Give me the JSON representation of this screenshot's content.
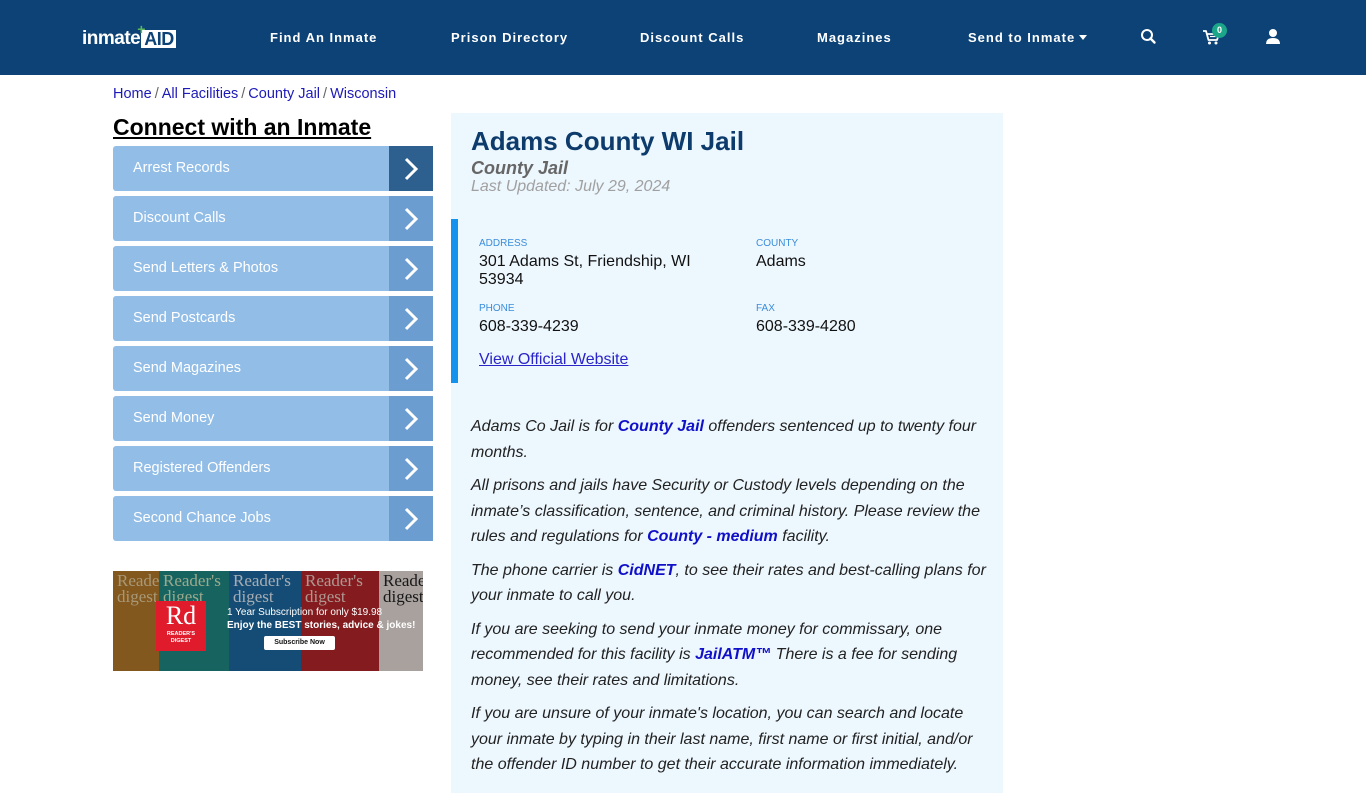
{
  "header": {
    "logo": {
      "part1": "inmate",
      "part2": "AID",
      "plus": "+"
    },
    "nav": [
      {
        "label": "Find An Inmate"
      },
      {
        "label": "Prison Directory"
      },
      {
        "label": "Discount Calls"
      },
      {
        "label": "Magazines"
      },
      {
        "label": "Send to Inmate",
        "has_dropdown": true
      }
    ],
    "icons": {
      "search": "search-icon",
      "cart": "cart-icon",
      "user": "user-icon"
    },
    "cart_count": "0",
    "colors": {
      "background": "#0c4276",
      "badge": "#1ba589"
    }
  },
  "breadcrumb": [
    {
      "label": "Home"
    },
    {
      "label": "All Facilities"
    },
    {
      "label": "County Jail"
    },
    {
      "label": "Wisconsin"
    }
  ],
  "breadcrumb_sep": "/",
  "sidebar": {
    "title": "Connect with an Inmate",
    "items": [
      {
        "label": "Arrest Records",
        "active": true
      },
      {
        "label": "Discount Calls"
      },
      {
        "label": "Send Letters & Photos"
      },
      {
        "label": "Send Postcards"
      },
      {
        "label": "Send Magazines"
      },
      {
        "label": "Send Money"
      },
      {
        "label": "Registered Offenders"
      },
      {
        "label": "Second Chance Jobs"
      }
    ],
    "ad": {
      "brand_short": "Rd",
      "brand_line1": "READER'S",
      "brand_line2": "DIGEST",
      "masthead": "Reader's digest",
      "line1": "1 Year Subscription for only $19.98",
      "line2": "Enjoy the BEST stories, advice & jokes!",
      "cta": "Subscribe Now"
    }
  },
  "facility": {
    "name": "Adams County WI Jail",
    "type": "County Jail",
    "last_updated": "Last Updated: July 29, 2024",
    "address_label": "ADDRESS",
    "address_line1": "301 Adams St, Friendship, WI",
    "address_line2": "53934",
    "county_label": "COUNTY",
    "county": "Adams",
    "phone_label": "PHONE",
    "phone": "608-339-4239",
    "fax_label": "FAX",
    "fax": "608-339-4280",
    "website_link": "View Official Website"
  },
  "body": {
    "p1": {
      "a": "Adams Co Jail is for ",
      "link": "County Jail",
      "b": " offenders sentenced up to twenty four months."
    },
    "p2": {
      "a": "All prisons and jails have Security or Custody levels depending on the inmate’s classification, sentence, and criminal history. Please review the rules and regulations for ",
      "link": "County - medium",
      "b": " facility."
    },
    "p3": {
      "a": "The phone carrier is ",
      "link": "CidNET",
      "b": ", to see their rates and best-calling plans for your inmate to call you."
    },
    "p4": {
      "a": "If you are seeking to send your inmate money for commissary, one recommended for this facility is ",
      "link": "JailATM™",
      "b": " There is a fee for sending money, see their rates and limitations."
    },
    "p5": {
      "a": "If you are unsure of your inmate's location, you can search and locate your inmate by typing in their last name, first name or first initial, and/or the offender ID number to get their accurate information immediately."
    }
  }
}
